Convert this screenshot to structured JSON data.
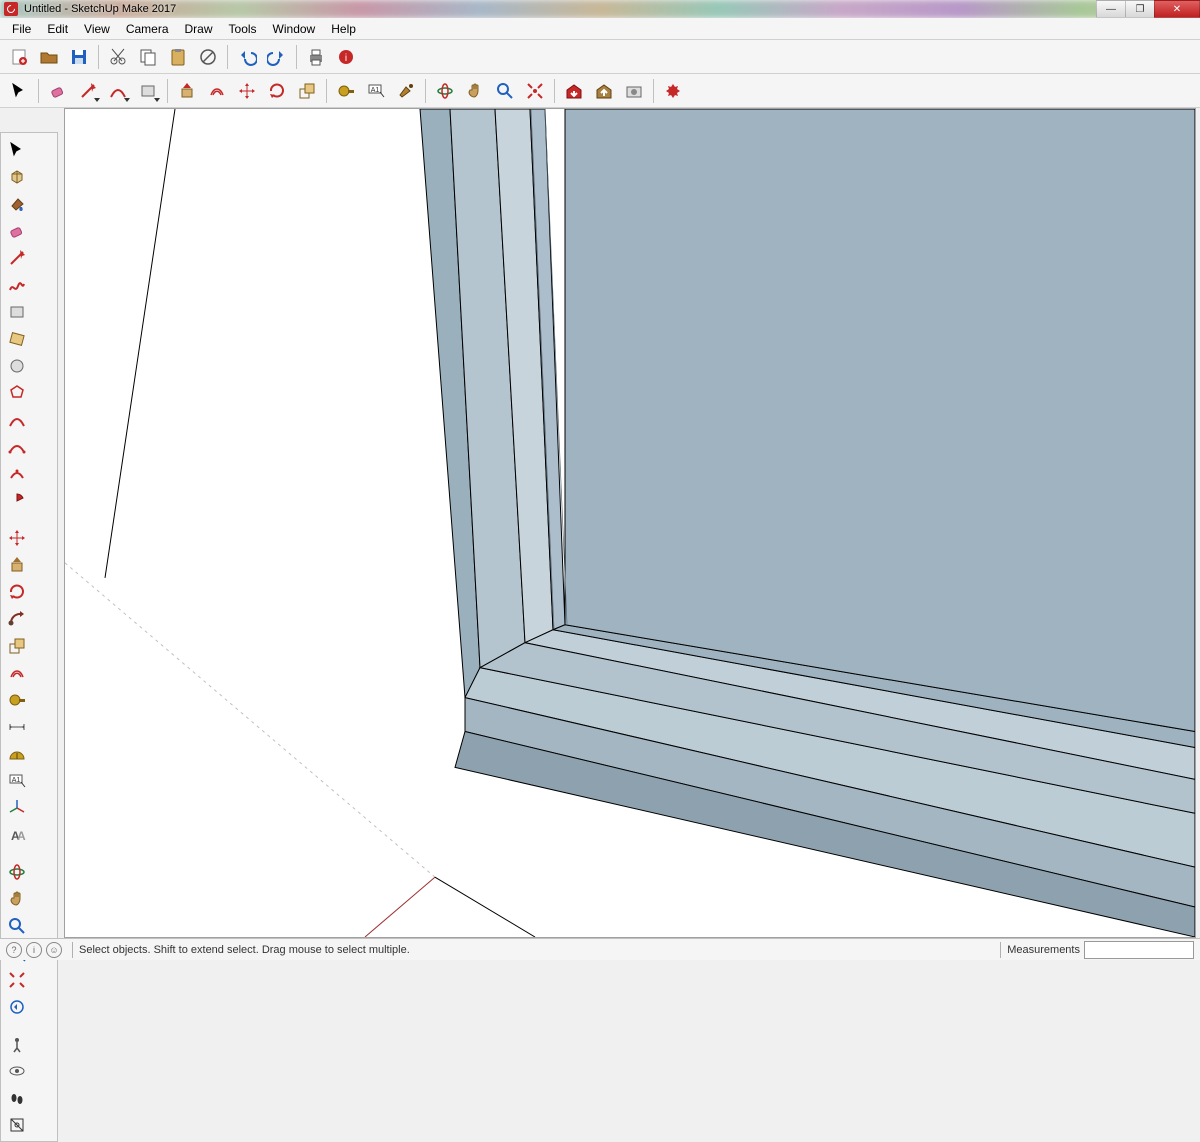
{
  "window": {
    "title": "Untitled - SketchUp Make 2017"
  },
  "menu": [
    "File",
    "Edit",
    "View",
    "Camera",
    "Draw",
    "Tools",
    "Window",
    "Help"
  ],
  "statusbar": {
    "hint": "Select objects. Shift to extend select. Drag mouse to select multiple.",
    "measurements_label": "Measurements"
  },
  "toolbar_main": [
    {
      "n": "new-model",
      "c": "#c62828"
    },
    {
      "n": "open-model",
      "c": "#b07830"
    },
    {
      "n": "save-model",
      "c": "#2060c0"
    },
    "sep",
    {
      "n": "cut",
      "c": "#555"
    },
    {
      "n": "copy",
      "c": "#555"
    },
    {
      "n": "paste",
      "c": "#555"
    },
    {
      "n": "erase",
      "c": "#555"
    },
    "sep",
    {
      "n": "undo",
      "c": "#2060c0"
    },
    {
      "n": "redo",
      "c": "#2060c0"
    },
    "sep",
    {
      "n": "print",
      "c": "#333"
    },
    {
      "n": "model-info",
      "c": "#c62828"
    }
  ],
  "toolbar_tools": [
    {
      "n": "select-tool",
      "c": "#000"
    },
    "sep",
    {
      "n": "eraser-tool",
      "c": "#e070a0"
    },
    {
      "n": "line-tool",
      "c": "#c62828",
      "dd": true
    },
    {
      "n": "arc-tool",
      "c": "#c62828",
      "dd": true
    },
    {
      "n": "shape-tool",
      "c": "#888",
      "dd": true
    },
    "sep",
    {
      "n": "pushpull-tool",
      "c": "#c62828"
    },
    {
      "n": "offset-tool",
      "c": "#c62828"
    },
    {
      "n": "move-tool",
      "c": "#c62828"
    },
    {
      "n": "rotate-tool",
      "c": "#c62828"
    },
    {
      "n": "scale-tool",
      "c": "#b08030"
    },
    "sep",
    {
      "n": "tape-tool",
      "c": "#c8a020"
    },
    {
      "n": "text-tool",
      "c": "#333"
    },
    {
      "n": "paint-tool",
      "c": "#b08030"
    },
    "sep",
    {
      "n": "orbit-tool",
      "c": "#208040"
    },
    {
      "n": "pan-tool",
      "c": "#c8a060"
    },
    {
      "n": "zoom-tool",
      "c": "#2060c0"
    },
    {
      "n": "zoom-extents-tool",
      "c": "#c62828"
    },
    "sep",
    {
      "n": "warehouse-get",
      "c": "#c62828"
    },
    {
      "n": "warehouse-share",
      "c": "#a88040"
    },
    {
      "n": "extension-warehouse",
      "c": "#888"
    },
    "sep",
    {
      "n": "extension-manager",
      "c": "#c62828"
    }
  ],
  "tool_tray": [
    [
      {
        "n": "select-tool",
        "c": "#000"
      },
      {
        "n": "make-component",
        "c": "#a88040"
      }
    ],
    [
      {
        "n": "paint-bucket",
        "c": "#a06030"
      },
      {
        "n": "eraser-tool",
        "c": "#e070a0"
      }
    ],
    [
      {
        "n": "line-tool",
        "c": "#c62828"
      },
      {
        "n": "freehand-tool",
        "c": "#c62828"
      }
    ],
    [
      {
        "n": "rectangle-tool",
        "c": "#888"
      },
      {
        "n": "rotated-rect-tool",
        "c": "#a07030"
      }
    ],
    [
      {
        "n": "circle-tool",
        "c": "#808080"
      },
      {
        "n": "polygon-tool",
        "c": "#c62828"
      }
    ],
    [
      {
        "n": "arc-tool",
        "c": "#c62828"
      },
      {
        "n": "two-point-arc",
        "c": "#c62828"
      }
    ],
    [
      {
        "n": "three-point-arc",
        "c": "#c62828"
      },
      {
        "n": "pie-tool",
        "c": "#c62828"
      }
    ],
    "gap",
    [
      {
        "n": "move-tool",
        "c": "#c62828"
      },
      {
        "n": "pushpull-tool",
        "c": "#a07030"
      }
    ],
    [
      {
        "n": "rotate-tool",
        "c": "#c62828"
      },
      {
        "n": "followme-tool",
        "c": "#803020"
      }
    ],
    [
      {
        "n": "scale-tool",
        "c": "#c62828"
      },
      {
        "n": "offset-tool",
        "c": "#c62828"
      }
    ],
    [
      {
        "n": "tape-tool",
        "c": "#c8a020"
      },
      {
        "n": "dimension-tool",
        "c": "#555"
      }
    ],
    [
      {
        "n": "protractor-tool",
        "c": "#c8a020"
      },
      {
        "n": "text-tool",
        "c": "#333"
      }
    ],
    [
      {
        "n": "axes-tool",
        "c": "#208040"
      },
      {
        "n": "3dtext-tool",
        "c": "#555"
      }
    ],
    "gap",
    [
      {
        "n": "orbit-tool",
        "c": "#208040"
      },
      {
        "n": "pan-tool",
        "c": "#c8a060"
      }
    ],
    [
      {
        "n": "zoom-tool",
        "c": "#2060c0"
      },
      {
        "n": "zoom-window",
        "c": "#c62828"
      }
    ],
    [
      {
        "n": "zoom-extents",
        "c": "#c62828"
      },
      {
        "n": "previous-view",
        "c": "#2060c0"
      }
    ],
    "gap",
    [
      {
        "n": "position-camera",
        "c": "#555"
      },
      {
        "n": "look-around",
        "c": "#555"
      }
    ],
    [
      {
        "n": "walk-tool",
        "c": "#333"
      },
      {
        "n": "section-plane",
        "c": "#333"
      }
    ]
  ]
}
